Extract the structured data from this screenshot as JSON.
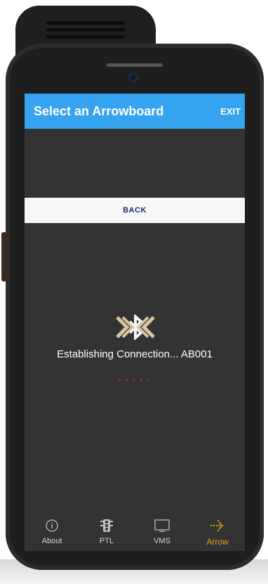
{
  "app": {
    "title": "Select an Arrowboard",
    "exit_label": "EXIT",
    "back_label": "BACK",
    "status_text": "Establishing Connection... AB001",
    "progress_dots": "• • • • •",
    "accent_color": "#36a3f0",
    "active_color": "#e3a21e"
  },
  "bottom_nav": {
    "items": [
      {
        "label": "About",
        "icon": "info-icon",
        "active": false
      },
      {
        "label": "PTL",
        "icon": "traffic-light-icon",
        "active": false
      },
      {
        "label": "VMS",
        "icon": "monitor-icon",
        "active": false
      },
      {
        "label": "Arrow",
        "icon": "arrow-icon",
        "active": true
      }
    ]
  }
}
